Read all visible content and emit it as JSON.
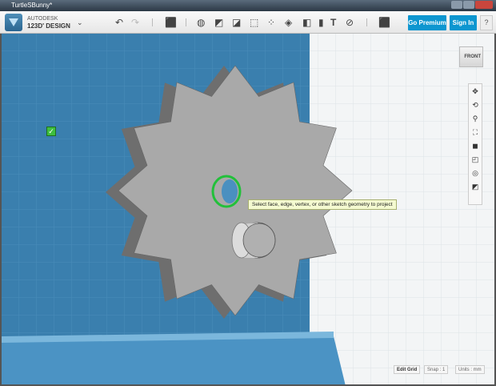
{
  "window": {
    "title": "TurtleSBunny*"
  },
  "brand": {
    "line1": "AUTODESK",
    "line2": "123D' DESIGN"
  },
  "toolbar": {
    "go_premium": "Go Premium",
    "sign_in": "Sign In",
    "help": "?"
  },
  "tooltip": "Select face, edge, vertex, or other sketch geometry to project",
  "viewcube": {
    "face": "FRONT"
  },
  "status": {
    "edit_grid": "Edit Grid",
    "snap": "Snap : 1",
    "units": "Units : mm"
  },
  "colors": {
    "accent": "#0d96d0",
    "wall": "#3a7fae",
    "gear": "#a9a9a9",
    "highlight": "#2ecc40"
  }
}
